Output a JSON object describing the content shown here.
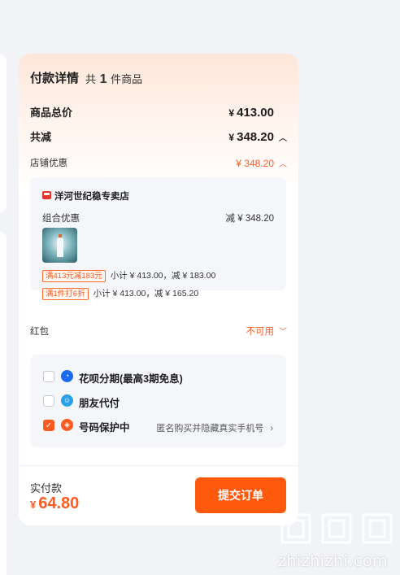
{
  "payment_details": {
    "title": "付款详情",
    "count_prefix": "共",
    "count": "1",
    "count_suffix": "件商品",
    "goods_total_label": "商品总价",
    "goods_total_yen": "¥",
    "goods_total_value": "413.00",
    "total_discount_label": "共减",
    "total_discount_yen": "¥",
    "total_discount_value": "348.20",
    "store_discount_label": "店铺优惠",
    "store_discount_value": "¥ 348.20"
  },
  "shop": {
    "name": "洋河世纪稳专卖店",
    "combo_label": "组合优惠",
    "combo_amount": "减 ¥ 348.20",
    "promos": [
      {
        "tag": "满413元减183元",
        "text": "小计 ¥ 413.00，减 ¥ 183.00"
      },
      {
        "tag": "满1件打6折",
        "text": "小计 ¥ 413.00，减 ¥ 165.20"
      }
    ]
  },
  "red_packet": {
    "label": "红包",
    "value": "不可用"
  },
  "payment_options": [
    {
      "label": "花呗分期(最高3期免息)",
      "checked": false,
      "icon": "huabei-icon",
      "color": "#1a6bf0"
    },
    {
      "label": "朋友代付",
      "checked": false,
      "icon": "friend-pay-icon",
      "color": "#2aa0e8"
    },
    {
      "label": "号码保护中",
      "checked": true,
      "icon": "shield-icon",
      "color": "#ff5a1f",
      "hint": "匿名购买并隐藏真实手机号"
    }
  ],
  "footer": {
    "total_label": "实付款",
    "total_yen": "¥",
    "total_value": "64.80",
    "submit_label": "提交订单"
  },
  "watermark": {
    "text": "zhizhizhi.com"
  },
  "colors": {
    "accent": "#ff5a1f",
    "button": "#ff5a0c",
    "background": "#f1f3f7"
  }
}
